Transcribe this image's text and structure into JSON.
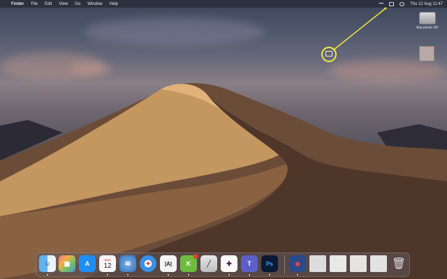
{
  "menubar": {
    "apple_glyph": "",
    "items": [
      "Finder",
      "File",
      "Edit",
      "View",
      "Go",
      "Window",
      "Help"
    ],
    "status": {
      "date_time": "Thu 12 Aug  11:47"
    }
  },
  "desktop": {
    "hd_label": "Macintosh HD"
  },
  "dock": {
    "calendar_month": "AUG",
    "calendar_day": "12",
    "photoshop_label": "Ps",
    "slack_badge": "1"
  },
  "colors": {
    "highlight": "#f4ea3a",
    "dune_light": "#c89a5e",
    "dune_dark": "#5a3f2f"
  }
}
